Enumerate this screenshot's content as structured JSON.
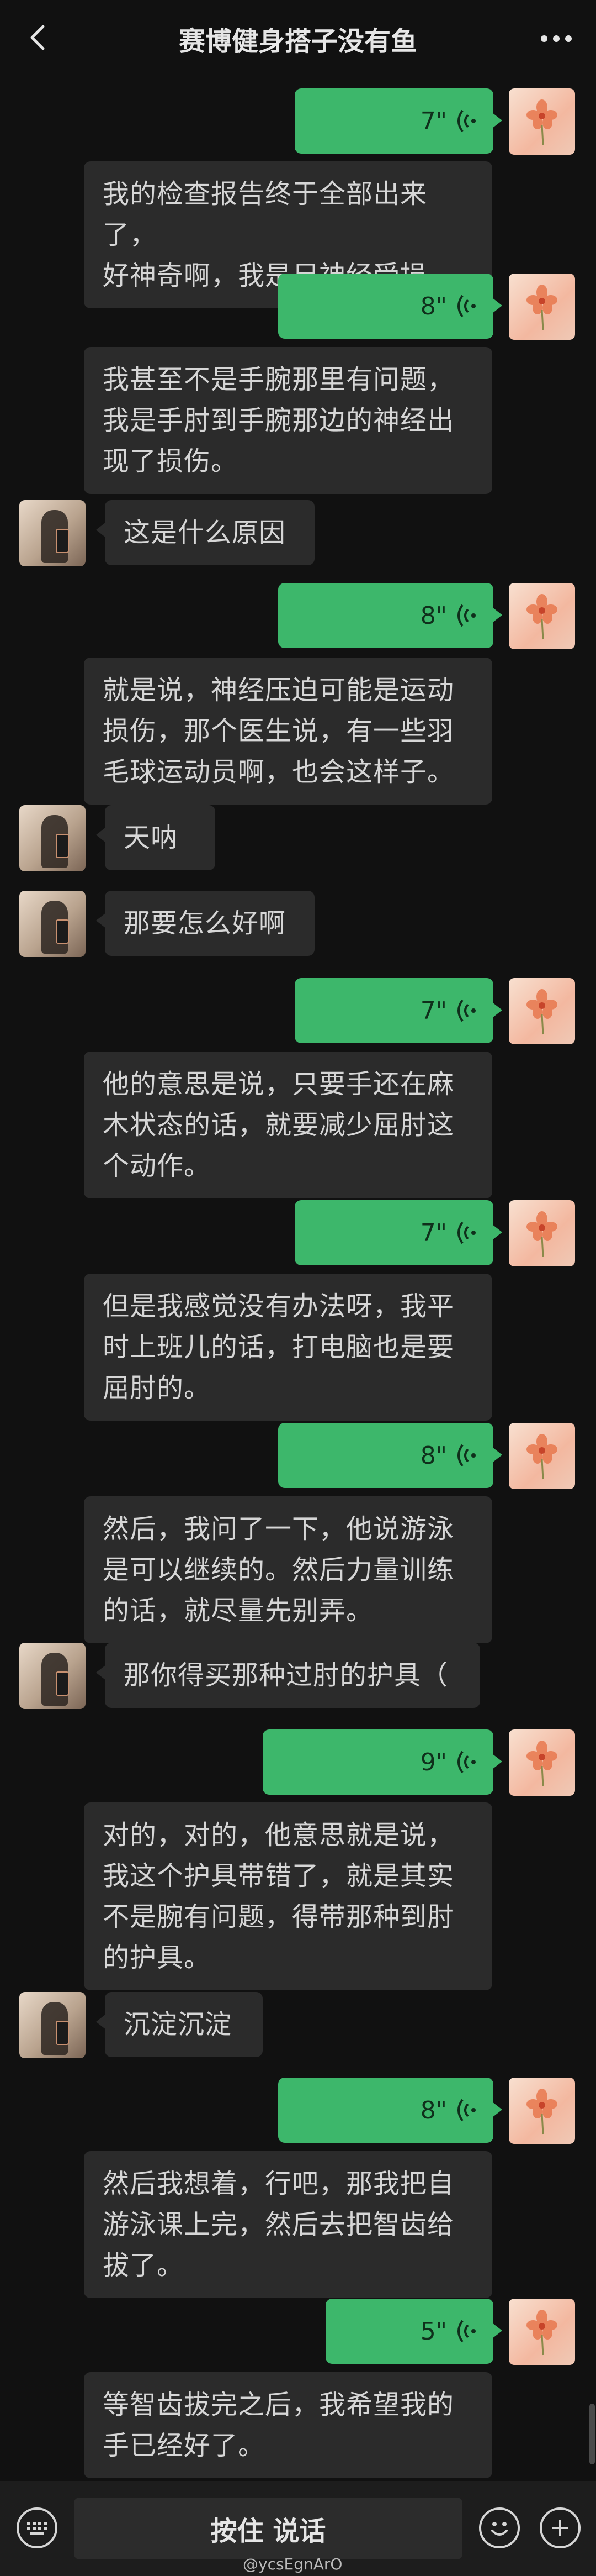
{
  "header": {
    "title": "赛博健身搭子没有鱼"
  },
  "messages": [
    {
      "type": "voice",
      "sender": "me",
      "duration": "7\""
    },
    {
      "type": "text",
      "sender": "me",
      "lines": [
        "我的检查报告终于全部出来了，",
        "好神奇啊，我是尺神经受损。"
      ]
    },
    {
      "type": "voice",
      "sender": "me",
      "duration": "8\""
    },
    {
      "type": "text",
      "sender": "me",
      "lines": [
        "我甚至不是手腕那里有问题，",
        "我是手肘到手腕那边的神经出",
        "现了损伤。"
      ]
    },
    {
      "type": "text",
      "sender": "friend",
      "lines": [
        "这是什么原因"
      ]
    },
    {
      "type": "voice",
      "sender": "me",
      "duration": "8\""
    },
    {
      "type": "text",
      "sender": "me",
      "lines": [
        "就是说，神经压迫可能是运动",
        "损伤，那个医生说，有一些羽",
        "毛球运动员啊，也会这样子。"
      ]
    },
    {
      "type": "text",
      "sender": "friend",
      "lines": [
        "天呐"
      ]
    },
    {
      "type": "text",
      "sender": "friend",
      "lines": [
        "那要怎么好啊"
      ]
    },
    {
      "type": "voice",
      "sender": "me",
      "duration": "7\""
    },
    {
      "type": "text",
      "sender": "me",
      "lines": [
        "他的意思是说，只要手还在麻",
        "木状态的话，就要减少屈肘这",
        "个动作。"
      ]
    },
    {
      "type": "voice",
      "sender": "me",
      "duration": "7\""
    },
    {
      "type": "text",
      "sender": "me",
      "lines": [
        "但是我感觉没有办法呀，我平",
        "时上班儿的话，打电脑也是要",
        "屈肘的。"
      ]
    },
    {
      "type": "voice",
      "sender": "me",
      "duration": "8\""
    },
    {
      "type": "text",
      "sender": "me",
      "lines": [
        "然后，我问了一下，他说游泳",
        "是可以继续的。然后力量训练",
        "的话，就尽量先别弄。"
      ]
    },
    {
      "type": "text",
      "sender": "friend",
      "lines": [
        "那你得买那种过肘的护具（"
      ]
    },
    {
      "type": "voice",
      "sender": "me",
      "duration": "9\""
    },
    {
      "type": "text",
      "sender": "me",
      "lines": [
        "对的，对的，他意思就是说，",
        "我这个护具带错了，就是其实",
        "不是腕有问题，得带那种到肘",
        "的护具。"
      ]
    },
    {
      "type": "text",
      "sender": "friend",
      "lines": [
        "沉淀沉淀"
      ]
    },
    {
      "type": "voice",
      "sender": "me",
      "duration": "8\""
    },
    {
      "type": "text",
      "sender": "me",
      "lines": [
        "然后我想着，行吧，那我把自",
        "游泳课上完，然后去把智齿给",
        "拔了。"
      ]
    },
    {
      "type": "voice",
      "sender": "me",
      "duration": "5\""
    },
    {
      "type": "text",
      "sender": "me",
      "lines": [
        "等智齿拔完之后，我希望我的",
        "手已经好了。"
      ]
    }
  ],
  "bottom_bar": {
    "hold_to_talk": "按住 说话"
  },
  "watermark": "@ycsEgnArO",
  "colors": {
    "background": "#111111",
    "voice_bubble": "#3db76b",
    "text_bubble": "#2b2b2b"
  }
}
